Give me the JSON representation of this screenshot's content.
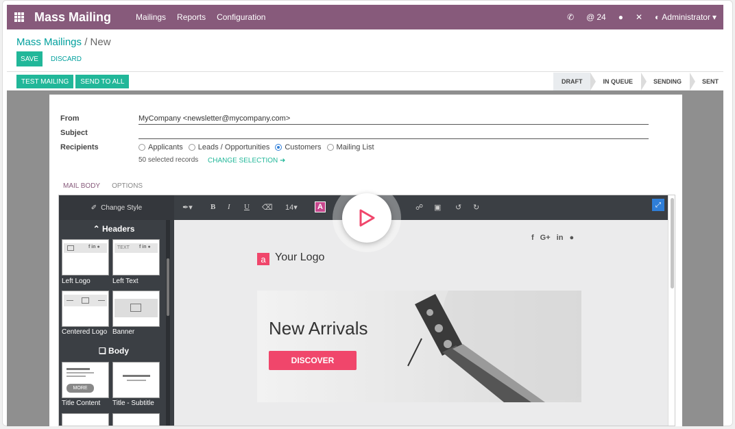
{
  "navbar": {
    "brand": "Mass Mailing",
    "menu": [
      "Mailings",
      "Reports",
      "Configuration"
    ],
    "message_count": "24",
    "user": "Administrator"
  },
  "breadcrumb": {
    "parent": "Mass Mailings",
    "separator": "/",
    "current": "New"
  },
  "actions": {
    "save": "SAVE",
    "discard": "DISCARD"
  },
  "header_buttons": {
    "test": "TEST MAILING",
    "send": "SEND TO ALL"
  },
  "status_stages": [
    "DRAFT",
    "IN QUEUE",
    "SENDING",
    "SENT"
  ],
  "form": {
    "from_label": "From",
    "from_value": "MyCompany <newsletter@mycompany.com>",
    "subject_label": "Subject",
    "recipients_label": "Recipients",
    "recipient_options": [
      "Applicants",
      "Leads / Opportunities",
      "Customers",
      "Mailing List"
    ],
    "selected_recipient": "Customers",
    "records": "50 selected records",
    "change_selection": "CHANGE SELECTION"
  },
  "tabs": [
    "MAIL BODY",
    "OPTIONS"
  ],
  "editor": {
    "change_style": "Change Style",
    "font_size": "14",
    "snippet_groups": {
      "headers": "Headers",
      "body": "Body"
    },
    "snippets": [
      "Left Logo",
      "Left Text",
      "Centered Logo",
      "Banner",
      "Title Content",
      "Title - Subtitle"
    ],
    "snippet_more": "MORE",
    "snippet_text": "TEXT"
  },
  "content": {
    "logo_letter": "a",
    "logo_text": "Your Logo",
    "social": [
      "f",
      "G+",
      "in"
    ],
    "banner_title": "New Arrivals",
    "banner_button": "DISCOVER"
  },
  "colors": {
    "brand": "#875a7b",
    "accent": "#21b799",
    "pink": "#f0466b"
  }
}
